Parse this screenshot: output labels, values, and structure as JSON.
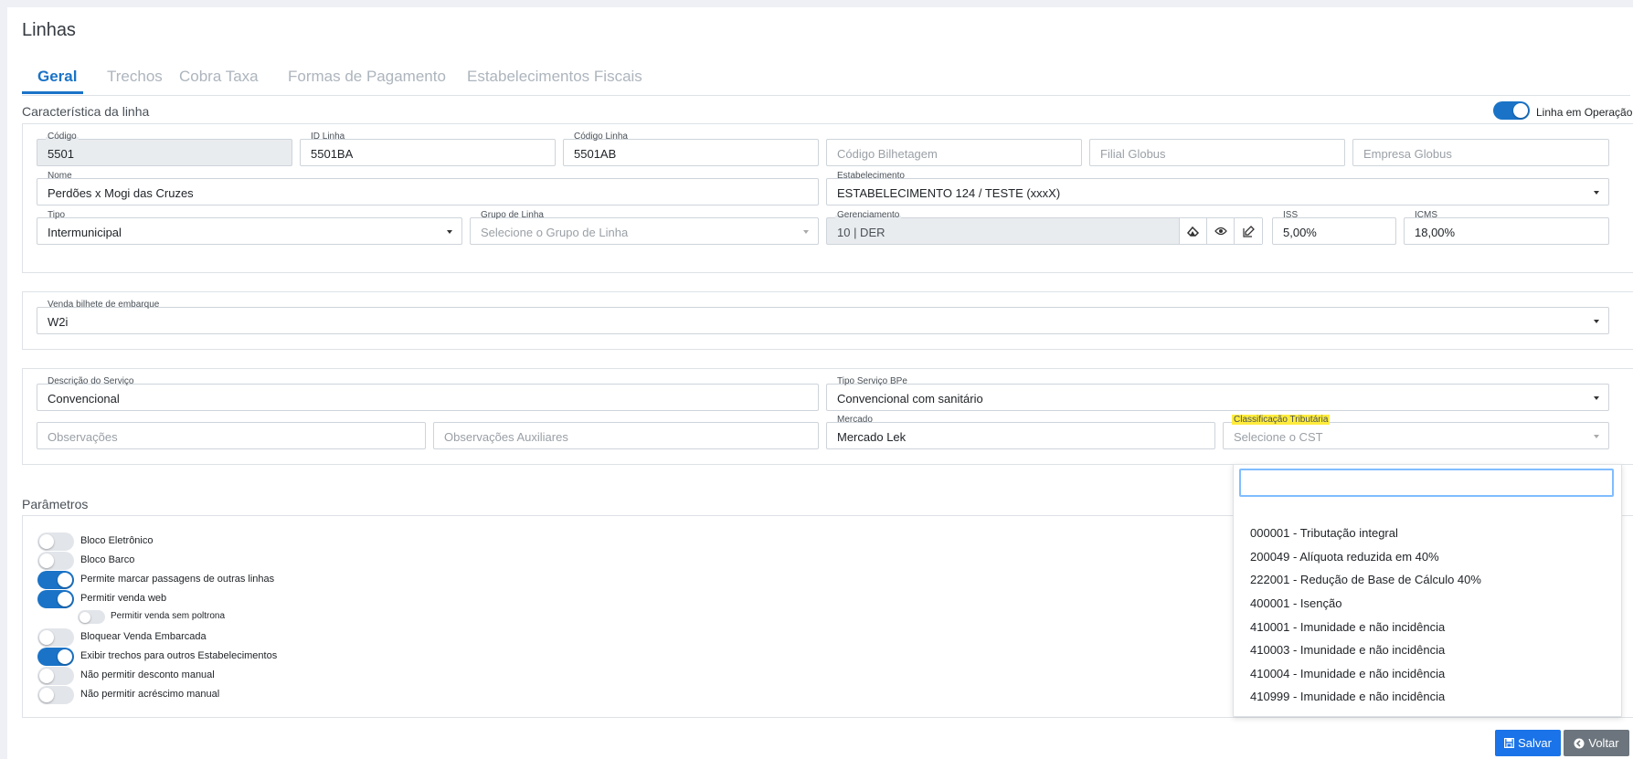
{
  "page_title": "Linhas",
  "tabs": [
    "Geral",
    "Trechos",
    "Cobra Taxa",
    "Formas de Pagamento",
    "Estabelecimentos Fiscais"
  ],
  "caracteristica": {
    "title": "Característica da linha",
    "operacao_label": "Linha em Operação",
    "codigo": {
      "label": "Código",
      "value": "5501"
    },
    "id_linha": {
      "label": "ID Linha",
      "value": "5501BA"
    },
    "codigo_linha": {
      "label": "Código Linha",
      "value": "5501AB"
    },
    "codigo_bilhetagem": {
      "placeholder": "Código Bilhetagem"
    },
    "filial_globus": {
      "placeholder": "Filial Globus"
    },
    "empresa_globus": {
      "placeholder": "Empresa Globus"
    },
    "nome": {
      "label": "Nome",
      "value": "Perdões x Mogi das Cruzes"
    },
    "estabelecimento": {
      "label": "Estabelecimento",
      "value": "ESTABELECIMENTO 124 / TESTE (xxxX)"
    },
    "tipo": {
      "label": "Tipo",
      "value": "Intermunicipal"
    },
    "grupo_linha": {
      "label": "Grupo de Linha",
      "placeholder": "Selecione o Grupo de Linha"
    },
    "gerenciamento": {
      "label": "Gerenciamento",
      "value": "10 | DER"
    },
    "iss": {
      "label": "ISS",
      "value": "5,00%"
    },
    "icms": {
      "label": "ICMS",
      "value": "18,00%"
    }
  },
  "venda": {
    "label": "Venda bilhete de embarque",
    "value": "W2i"
  },
  "servico": {
    "descricao": {
      "label": "Descrição do Serviço",
      "value": "Convencional"
    },
    "tipo_bpe": {
      "label": "Tipo Serviço BPe",
      "value": "Convencional com sanitário"
    },
    "observacoes": {
      "placeholder": "Observações"
    },
    "obs_aux": {
      "placeholder": "Observações Auxiliares"
    },
    "mercado": {
      "label": "Mercado",
      "value": "Mercado  Lek"
    },
    "classificacao": {
      "label": "Classificação Tributária",
      "placeholder": "Selecione o CST"
    }
  },
  "cst_options": [
    "000001 - Tributação integral",
    "200049 - Alíquota reduzida em 40%",
    "222001 - Redução de Base de Cálculo 40%",
    "400001 - Isenção",
    "410001 - Imunidade e não incidência",
    "410003 - Imunidade e não incidência",
    "410004 - Imunidade e não incidência",
    "410999 - Imunidade e não incidência"
  ],
  "parametros": {
    "title": "Parâmetros",
    "items": [
      {
        "label": "Bloco Eletrônico",
        "on": false
      },
      {
        "label": "Bloco Barco",
        "on": false
      },
      {
        "label": "Permite marcar passagens de outras linhas",
        "on": true
      },
      {
        "label": "Permitir venda web",
        "on": true
      },
      {
        "label": "Permitir venda sem poltrona",
        "on": false
      },
      {
        "label": "Bloquear Venda Embarcada",
        "on": false
      },
      {
        "label": "Exibir trechos para outros Estabelecimentos",
        "on": true
      },
      {
        "label": "Não permitir desconto manual",
        "on": false
      },
      {
        "label": "Não permitir acréscimo manual",
        "on": false
      }
    ]
  },
  "buttons": {
    "salvar": "Salvar",
    "voltar": "Voltar"
  },
  "colors": {
    "accent": "#1a73c7",
    "highlight": "#ffec3d",
    "voltar": "#6c757d"
  }
}
